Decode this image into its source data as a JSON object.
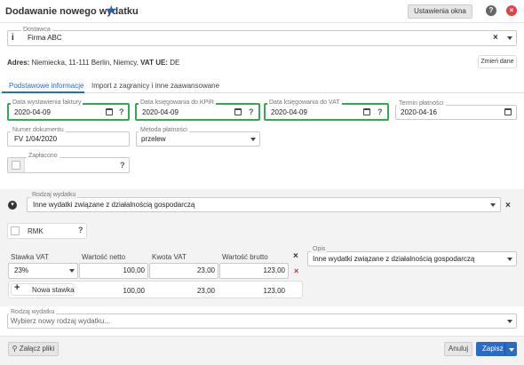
{
  "header": {
    "title": "Dodawanie nowego wydatku",
    "window_settings_label": "Ustawienia okna",
    "help_glyph": "?",
    "close_glyph": "×"
  },
  "supplier": {
    "label": "Dostawca",
    "value": "Firma ABC",
    "address_prefix": "Adres:",
    "address": "Niemiecka, 11-111 Berlin, Niemcy,",
    "vat_prefix": "VAT UE:",
    "vat_value": "DE",
    "change_label": "Zmień dane"
  },
  "tabs": [
    {
      "label": "Podstawowe informacje",
      "active": true
    },
    {
      "label": "Import z zagranicy i inne zaawansowane",
      "active": false
    }
  ],
  "fields": {
    "issue_date": {
      "label": "Data wystawienia faktury",
      "value": "2020-04-09"
    },
    "kpir_date": {
      "label": "Data księgowania do KPiR",
      "value": "2020-04-09"
    },
    "vat_date": {
      "label": "Data księgowania do VAT",
      "value": "2020-04-09"
    },
    "payment_due": {
      "label": "Termin płatności",
      "value": "2020-04-16"
    },
    "doc_number": {
      "label": "Numer dokumentu",
      "value": "FV 1/04/2020"
    },
    "payment_method": {
      "label": "Metoda płatności",
      "value": "przelew"
    },
    "paid": {
      "label": "Zapłacono",
      "value": ""
    }
  },
  "expense_type": {
    "label": "Rodzaj wydatku",
    "value": "Inne wydatki związane z działalnością gospodarczą"
  },
  "rmk": {
    "label": "RMK"
  },
  "vat_table": {
    "headers": [
      "Stawka VAT",
      "Wartość netto",
      "Kwota VAT",
      "Wartość brutto"
    ],
    "rows": [
      {
        "rate": "23%",
        "net": "100,00",
        "vat": "23,00",
        "gross": "123,00"
      }
    ],
    "add_label": "Nowa stawka",
    "totals": {
      "net": "100,00",
      "vat": "23,00",
      "gross": "123,00"
    }
  },
  "description": {
    "label": "Opis",
    "value": "Inne wydatki związane z działalnością gospodarczą"
  },
  "expense_type2": {
    "label": "Rodzaj wydatku",
    "placeholder": "Wybierz nowy rodzaj wydatku..."
  },
  "footer": {
    "attach_label": "Załącz pliki",
    "cancel_label": "Anuluj",
    "save_label": "Zapisz"
  },
  "colors": {
    "accent": "#2a6bc6",
    "highlight": "#35a853",
    "danger": "#e04343"
  }
}
